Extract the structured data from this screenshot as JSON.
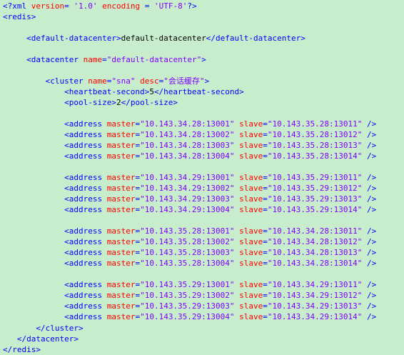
{
  "xml_decl": {
    "open": "<?xml",
    "version_attr": "version",
    "version_val": "'1.0'",
    "encoding_attr": "encoding",
    "encoding_val": "'UTF-8'",
    "close": "?>"
  },
  "redis": {
    "open": "<redis>",
    "close": "</redis>"
  },
  "default_datacenter": {
    "open": "<default-datacenter>",
    "text": "default-datacenter",
    "close": "</default-datacenter>"
  },
  "datacenter": {
    "open": "<datacenter",
    "name_attr": "name",
    "name_val": "\"default-datacenter\"",
    "gt": ">",
    "close": "</datacenter>"
  },
  "cluster": {
    "open": "<cluster",
    "name_attr": "name",
    "name_val": "\"sna\"",
    "desc_attr": "desc",
    "desc_val": "\"会话缓存\"",
    "gt": ">",
    "close": "</cluster>"
  },
  "heartbeat": {
    "open": "<heartbeat-second>",
    "text": "5",
    "close": "</heartbeat-second>"
  },
  "poolsize": {
    "open": "<pool-size>",
    "text": "2",
    "close": "</pool-size>"
  },
  "address_tag": "<address",
  "master_attr": "master",
  "slave_attr": "slave",
  "self_close": "/>",
  "addresses": [
    {
      "master": "\"10.143.34.28:13001\"",
      "slave": "\"10.143.35.28:13011\""
    },
    {
      "master": "\"10.143.34.28:13002\"",
      "slave": "\"10.143.35.28:13012\""
    },
    {
      "master": "\"10.143.34.28:13003\"",
      "slave": "\"10.143.35.28:13013\""
    },
    {
      "master": "\"10.143.34.28:13004\"",
      "slave": "\"10.143.35.28:13014\""
    },
    {
      "master": "\"10.143.34.29:13001\"",
      "slave": "\"10.143.35.29:13011\""
    },
    {
      "master": "\"10.143.34.29:13002\"",
      "slave": "\"10.143.35.29:13012\""
    },
    {
      "master": "\"10.143.34.29:13003\"",
      "slave": "\"10.143.35.29:13013\""
    },
    {
      "master": "\"10.143.34.29:13004\"",
      "slave": "\"10.143.35.29:13014\""
    },
    {
      "master": "\"10.143.35.28:13001\"",
      "slave": "\"10.143.34.28:13011\""
    },
    {
      "master": "\"10.143.35.28:13002\"",
      "slave": "\"10.143.34.28:13012\""
    },
    {
      "master": "\"10.143.35.28:13003\"",
      "slave": "\"10.143.34.28:13013\""
    },
    {
      "master": "\"10.143.35.28:13004\"",
      "slave": "\"10.143.34.28:13014\""
    },
    {
      "master": "\"10.143.35.29:13001\"",
      "slave": "\"10.143.34.29:13011\""
    },
    {
      "master": "\"10.143.35.29:13002\"",
      "slave": "\"10.143.34.29:13012\""
    },
    {
      "master": "\"10.143.35.29:13003\"",
      "slave": "\"10.143.34.29:13013\""
    },
    {
      "master": "\"10.143.35.29:13004\"",
      "slave": "\"10.143.34.29:13014\""
    }
  ],
  "colors": {
    "background": "#c7edcc",
    "tag": "#0000ff",
    "attribute": "#ff0000",
    "value": "#8000ff",
    "text": "#000000"
  }
}
